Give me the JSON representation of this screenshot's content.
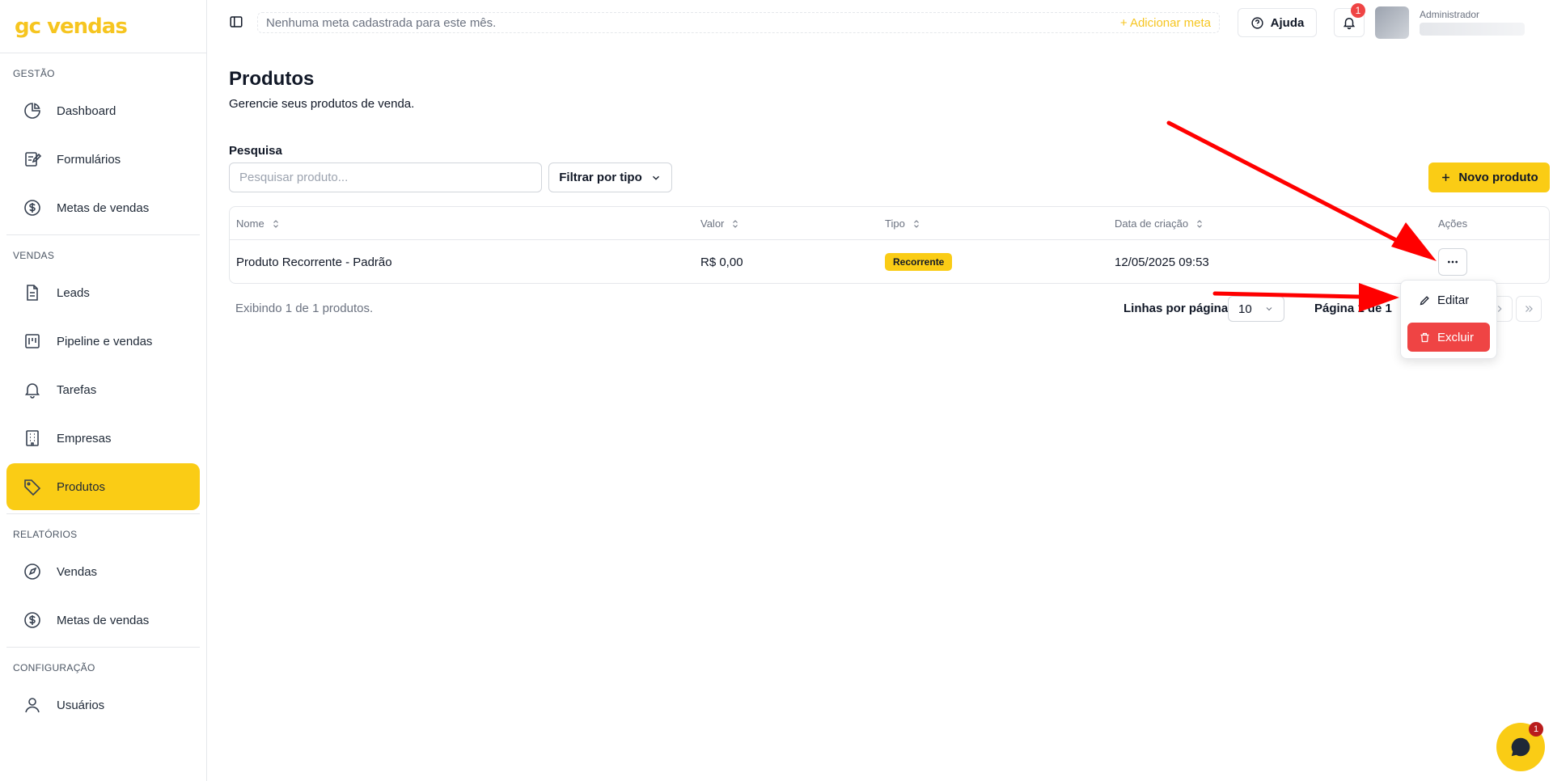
{
  "app": {
    "logo_text": "gc vendas",
    "brand_color": "#facc15"
  },
  "sidebar": {
    "sections": [
      {
        "title": "GESTÃO",
        "items": [
          {
            "label": "Dashboard",
            "icon": "pie-chart-icon"
          },
          {
            "label": "Formulários",
            "icon": "form-edit-icon"
          },
          {
            "label": "Metas de vendas",
            "icon": "dollar-circle-icon"
          }
        ]
      },
      {
        "title": "VENDAS",
        "items": [
          {
            "label": "Leads",
            "icon": "document-icon"
          },
          {
            "label": "Pipeline e vendas",
            "icon": "kanban-icon"
          },
          {
            "label": "Tarefas",
            "icon": "bell-icon"
          },
          {
            "label": "Empresas",
            "icon": "building-icon"
          },
          {
            "label": "Produtos",
            "icon": "tag-icon",
            "active": true
          }
        ]
      },
      {
        "title": "RELATÓRIOS",
        "items": [
          {
            "label": "Vendas",
            "icon": "compass-icon"
          },
          {
            "label": "Metas de vendas",
            "icon": "dollar-circle-icon"
          }
        ]
      },
      {
        "title": "CONFIGURAÇÃO",
        "items": [
          {
            "label": "Usuários",
            "icon": "user-icon"
          }
        ]
      }
    ]
  },
  "header": {
    "goal_text": "Nenhuma meta cadastrada para este mês.",
    "add_goal_label": "+ Adicionar meta",
    "help_label": "Ajuda",
    "notifications_count": "1",
    "user_role": "Administrador"
  },
  "page": {
    "title": "Produtos",
    "subtitle": "Gerencie seus produtos de venda.",
    "search_label": "Pesquisa",
    "search_placeholder": "Pesquisar produto...",
    "filter_label": "Filtrar por tipo",
    "new_button_label": "Novo produto"
  },
  "table": {
    "columns": [
      "Nome",
      "Valor",
      "Tipo",
      "Data de criação",
      "Ações"
    ],
    "rows": [
      {
        "nome": "Produto Recorrente - Padrão",
        "valor": "R$ 0,00",
        "tipo": "Recorrente",
        "data": "12/05/2025 09:53"
      }
    ]
  },
  "footer": {
    "info": "Exibindo 1 de 1 produtos.",
    "rows_per_page_label": "Linhas por página",
    "rows_per_page_value": "10",
    "page_label": "Página 1 de 1"
  },
  "dropdown": {
    "edit_label": "Editar",
    "delete_label": "Excluir"
  },
  "chat": {
    "badge": "1"
  },
  "colors": {
    "accent": "#facc15",
    "danger": "#ef4444",
    "arrow": "#ff0000"
  }
}
